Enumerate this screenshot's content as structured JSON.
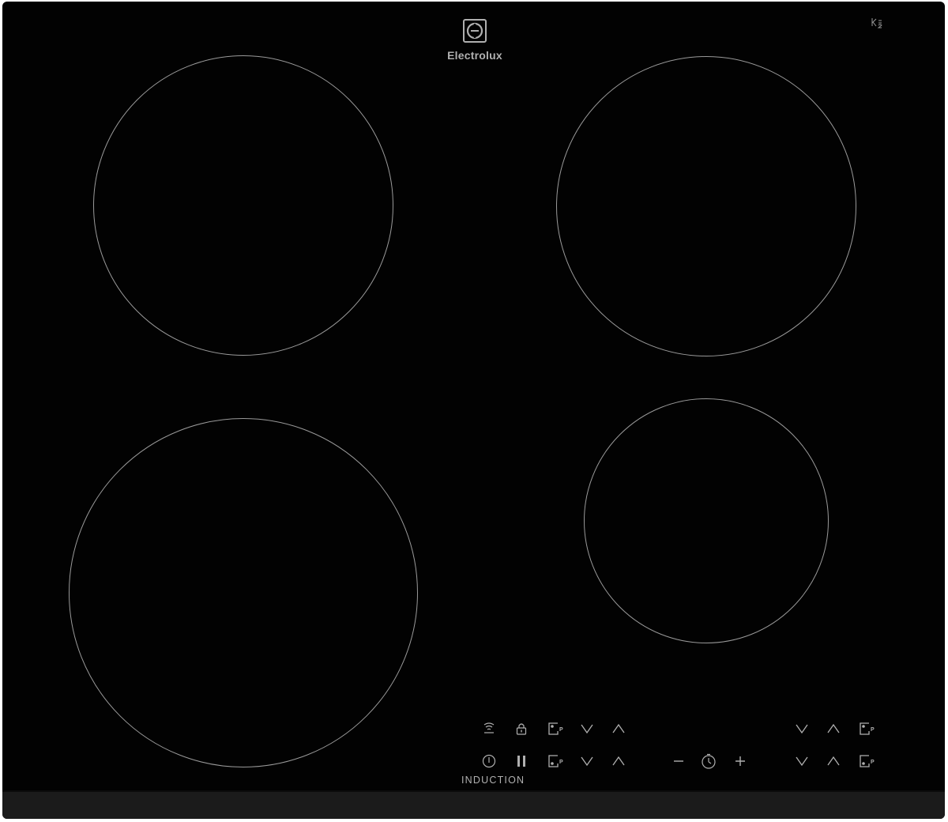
{
  "brand": {
    "name": "Electrolux",
    "logo_icon": "electrolux-logo-icon"
  },
  "hob": {
    "type_label": "INDUCTION",
    "cooking_zones": [
      "rear-left",
      "rear-right",
      "front-left",
      "front-right"
    ]
  },
  "controls": {
    "icons": [
      "hob2hood-icon",
      "lock-icon",
      "power-boost-icon",
      "chevron-down-icon",
      "chevron-up-icon",
      "power-icon",
      "pause-icon",
      "minus-icon",
      "timer-icon",
      "plus-icon"
    ]
  },
  "colors": {
    "glass": "#020202",
    "print": "#b0b0b0",
    "edge": "#1b1b1b"
  }
}
